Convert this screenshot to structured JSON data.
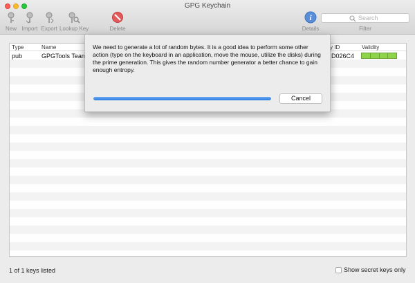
{
  "window": {
    "title": "GPG Keychain"
  },
  "toolbar": {
    "new_label": "New",
    "import_label": "Import",
    "export_label": "Export",
    "lookup_label": "Lookup Key",
    "delete_label": "Delete",
    "details_label": "Details",
    "filter_label": "Filter",
    "search_placeholder": "Search"
  },
  "table": {
    "columns": [
      "Type",
      "Name",
      "y ID",
      "Validity"
    ],
    "rows": [
      {
        "type": "pub",
        "name": "GPGTools Team",
        "key_id": "D026C4",
        "validity_segments": 4
      }
    ]
  },
  "dialog": {
    "message": "We need to generate a lot of random bytes. It is a good idea to perform some other action (type on the keyboard in an application, move the mouse, utilize the disks) during the prime generation. This gives the random number generator a better chance to gain enough entropy.",
    "progress_fraction": 1.0,
    "cancel_label": "Cancel"
  },
  "status": {
    "keys_listed": "1 of 1 keys listed",
    "show_secret_label": "Show secret keys only"
  },
  "colors": {
    "accent": "#2a7ee0",
    "validity": "#8fd34a",
    "delete": "#e35a5a",
    "details": "#5a8fd8"
  }
}
